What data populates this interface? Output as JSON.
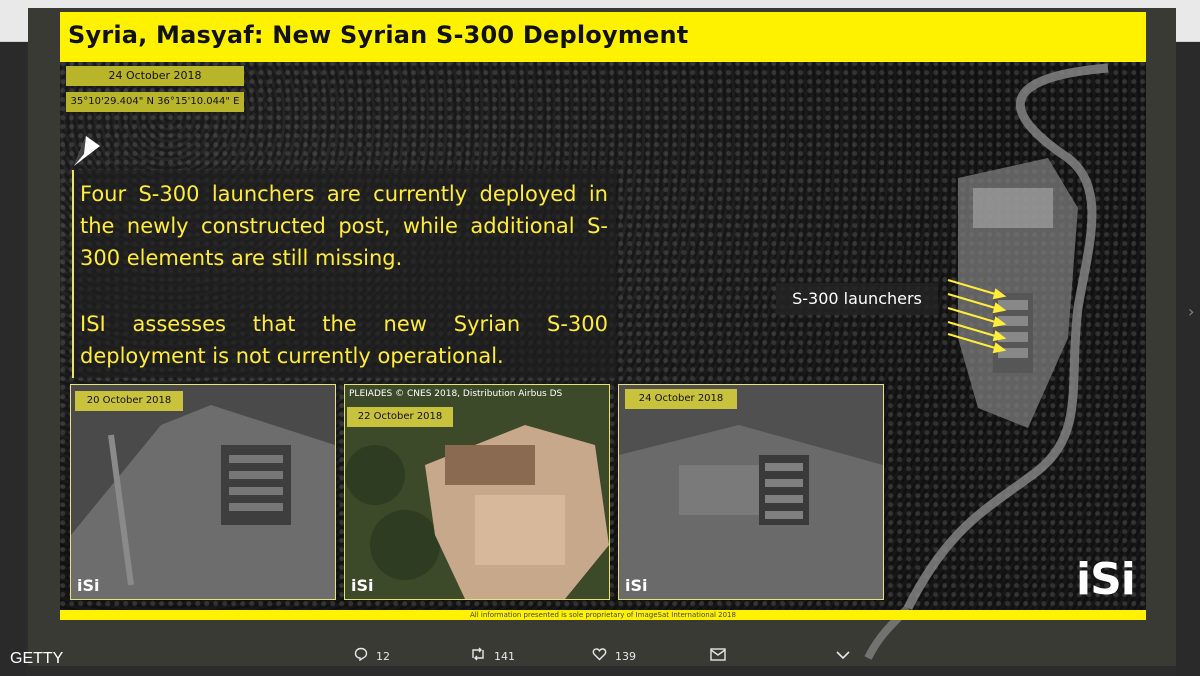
{
  "title": "Syria, Masyaf: New Syrian S-300 Deployment",
  "date": "24 October 2018",
  "coordinates": "35°10'29.404\" N 36°15'10.044\" E",
  "paragraph1": "Four S-300 launchers are currently deployed in the newly constructed post, while additional S-300 elements are still missing.",
  "paragraph2": "ISI assesses that the new Syrian S-300 deployment is not currently operational.",
  "launcher_label": "S-300 launchers",
  "insets": [
    {
      "date": "20 October 2018",
      "logo": "iSi"
    },
    {
      "date": "22 October 2018",
      "credit": "PLEIADES © CNES 2018, Distribution Airbus DS",
      "logo": "iSi"
    },
    {
      "date": "24 October 2018",
      "logo": "iSi"
    }
  ],
  "brand_logo": "iSi",
  "footer": "All information presented is sole proprietary of ImageSat International 2018",
  "actions": {
    "reply_count": "12",
    "retweet_count": "141",
    "like_count": "139"
  },
  "watermark": "GETTY",
  "colors": {
    "accent_yellow": "#fff200",
    "text_yellow": "#ffed3a"
  }
}
